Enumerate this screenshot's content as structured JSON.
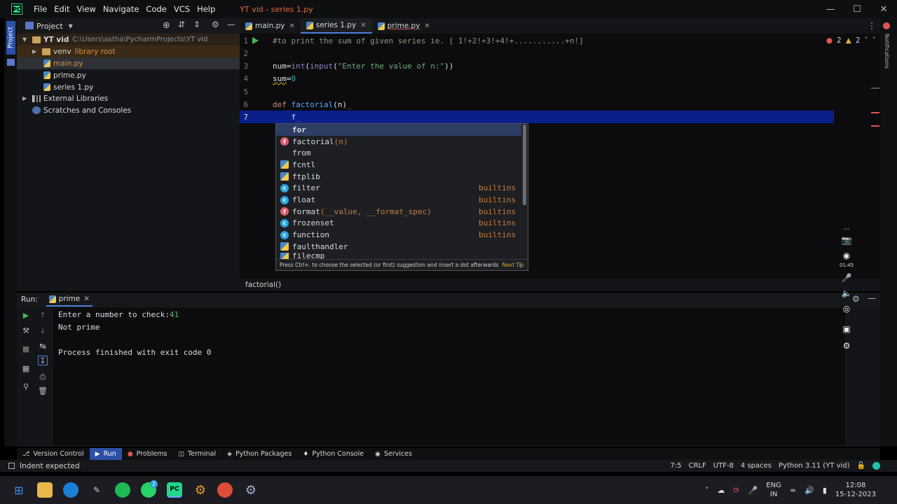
{
  "window": {
    "logo_text": "PC",
    "title": "YT vid - series 1.py",
    "menu": [
      "File",
      "Edit",
      "View",
      "Navigate",
      "Code",
      "VCS",
      "Help"
    ]
  },
  "project": {
    "side_tab": "Project",
    "header": "Project",
    "root_name": "YT vid",
    "root_path": "C:\\Users\\astha\\PycharmProjects\\YT vid",
    "venv": "venv",
    "venv_tag": "library root",
    "files": [
      "main.py",
      "prime.py",
      "series 1.py"
    ],
    "external": "External Libraries",
    "scratches": "Scratches and Consoles"
  },
  "editor": {
    "tabs": [
      {
        "label": "main.py"
      },
      {
        "label": "series 1.py"
      },
      {
        "label": "prime.py"
      }
    ],
    "errors": "2",
    "warnings": "2",
    "line_numbers": [
      "1",
      "2",
      "3",
      "4",
      "5",
      "6",
      "7"
    ],
    "lines": {
      "l1": "#to print the sum of given series ie. [ 1!+2!+3!+4!+...........+n!]",
      "l3a": "num=",
      "l3b": "int",
      "l3c": "(",
      "l3d": "input",
      "l3e": "(",
      "l3f": "\"Enter the value of n:\"",
      "l3g": "))",
      "l4a": "sum",
      "l4b": "=",
      "l4c": "0",
      "l6a": "def ",
      "l6b": "factorial",
      "l6c": "(n)",
      "l7": "    f"
    },
    "breadcrumb": "factorial()"
  },
  "completion": {
    "items": [
      {
        "icon": "",
        "label": "for",
        "sig": "",
        "tail": ""
      },
      {
        "icon": "f",
        "label": "factorial",
        "sig": "(n)",
        "tail": ""
      },
      {
        "icon": "",
        "label": "from",
        "sig": "",
        "tail": ""
      },
      {
        "icon": "m",
        "label": "fcntl",
        "sig": "",
        "tail": ""
      },
      {
        "icon": "m",
        "label": "ftplib",
        "sig": "",
        "tail": ""
      },
      {
        "icon": "c",
        "label": "filter",
        "sig": "",
        "tail": "builtins"
      },
      {
        "icon": "c",
        "label": "float",
        "sig": "",
        "tail": "builtins"
      },
      {
        "icon": "f",
        "label": "format",
        "sig": "(__value, __format_spec)",
        "tail": "builtins"
      },
      {
        "icon": "c",
        "label": "frozenset",
        "sig": "",
        "tail": "builtins"
      },
      {
        "icon": "c",
        "label": "function",
        "sig": "",
        "tail": "builtins"
      },
      {
        "icon": "m",
        "label": "faulthandler",
        "sig": "",
        "tail": ""
      },
      {
        "icon": "m",
        "label": "filecmp",
        "sig": "",
        "tail": ""
      }
    ],
    "footer": "Press Ctrl+. to choose the selected (or first) suggestion and insert a dot afterwards",
    "next_tip": "Next Tip"
  },
  "run": {
    "label": "Run:",
    "tab": "prime",
    "output": {
      "prompt": "Enter a number to check:",
      "input_value": "41",
      "result": "Not prime",
      "exit": "Process finished with exit code 0"
    }
  },
  "recorder": {
    "time": "01:45"
  },
  "tool_tabs": [
    "Version Control",
    "Run",
    "Problems",
    "Terminal",
    "Python Packages",
    "Python Console",
    "Services"
  ],
  "status": {
    "message": "Indent expected",
    "position": "7:5",
    "line_sep": "CRLF",
    "encoding": "UTF-8",
    "indent": "4 spaces",
    "interpreter": "Python 3.11 (YT vid)"
  },
  "tray": {
    "lang1": "ENG",
    "lang2": "IN",
    "time": "12:08",
    "date": "15-12-2023",
    "whatsapp_badge": "2"
  },
  "notifications_label": "Notifications",
  "colors": {
    "accent": "#2c4fa7",
    "current_line": "#0a1f8a",
    "error": "#e05555"
  }
}
